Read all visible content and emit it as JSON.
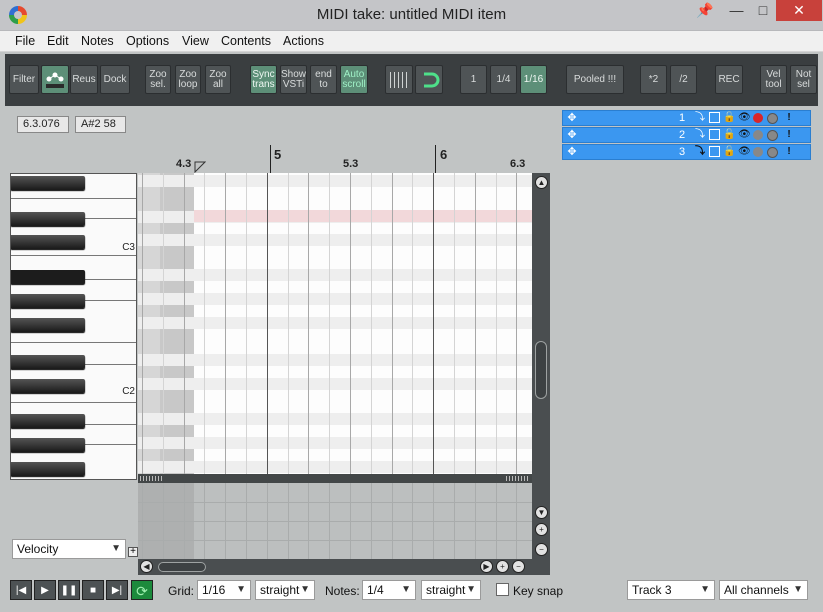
{
  "window": {
    "title": "MIDI take: untitled MIDI item",
    "pin_icon": "pin-icon",
    "minimize": "—",
    "maximize": "□",
    "close": "✕"
  },
  "menu": [
    "File",
    "Edit",
    "Notes",
    "Options",
    "View",
    "Contents",
    "Actions"
  ],
  "toolbar": {
    "filter": "Filter",
    "reus": "Reus",
    "dock": "Dock",
    "zoo_sel_1": "Zoo",
    "zoo_sel_2": "sel.",
    "zoo_loop_1": "Zoo",
    "zoo_loop_2": "loop",
    "zoo_all_1": "Zoo",
    "zoo_all_2": "all",
    "sync_1": "Sync",
    "sync_2": "trans",
    "show_1": "Show",
    "show_2": "VSTi",
    "end_1": "end",
    "end_2": "to",
    "auto_1": "Auto",
    "auto_2": "scroll",
    "q1": "1",
    "q14": "1/4",
    "q116": "1/16",
    "pooled": "Pooled !!!",
    "mul2": "*2",
    "div2": "/2",
    "rec": "REC",
    "vel_1": "Vel",
    "vel_2": "tool",
    "note_1": "Not",
    "note_2": "sel"
  },
  "info": {
    "position": "6.3.076",
    "note": "A#2  58"
  },
  "ruler": {
    "marks": [
      "4.3",
      "5",
      "5.3",
      "6",
      "6.3"
    ]
  },
  "piano": {
    "labels": [
      "C3",
      "C2"
    ]
  },
  "velocity_lane": {
    "selected": "Velocity",
    "add": "+"
  },
  "tracks": [
    {
      "number": "1"
    },
    {
      "number": "2"
    },
    {
      "number": "3"
    }
  ],
  "bottom": {
    "grid_label": "Grid:",
    "grid_value": "1/16",
    "grid_mode": "straight",
    "notes_label": "Notes:",
    "notes_value": "1/4",
    "notes_mode": "straight",
    "key_snap": "Key snap",
    "track": "Track 3",
    "channels": "All channels"
  },
  "colors": {
    "toolbar_bg": "#3a3e40",
    "active_button": "#5d8f78",
    "track_row": "#3b97f0",
    "close_button": "#c8413b",
    "loop_button": "#1c8a3c"
  }
}
